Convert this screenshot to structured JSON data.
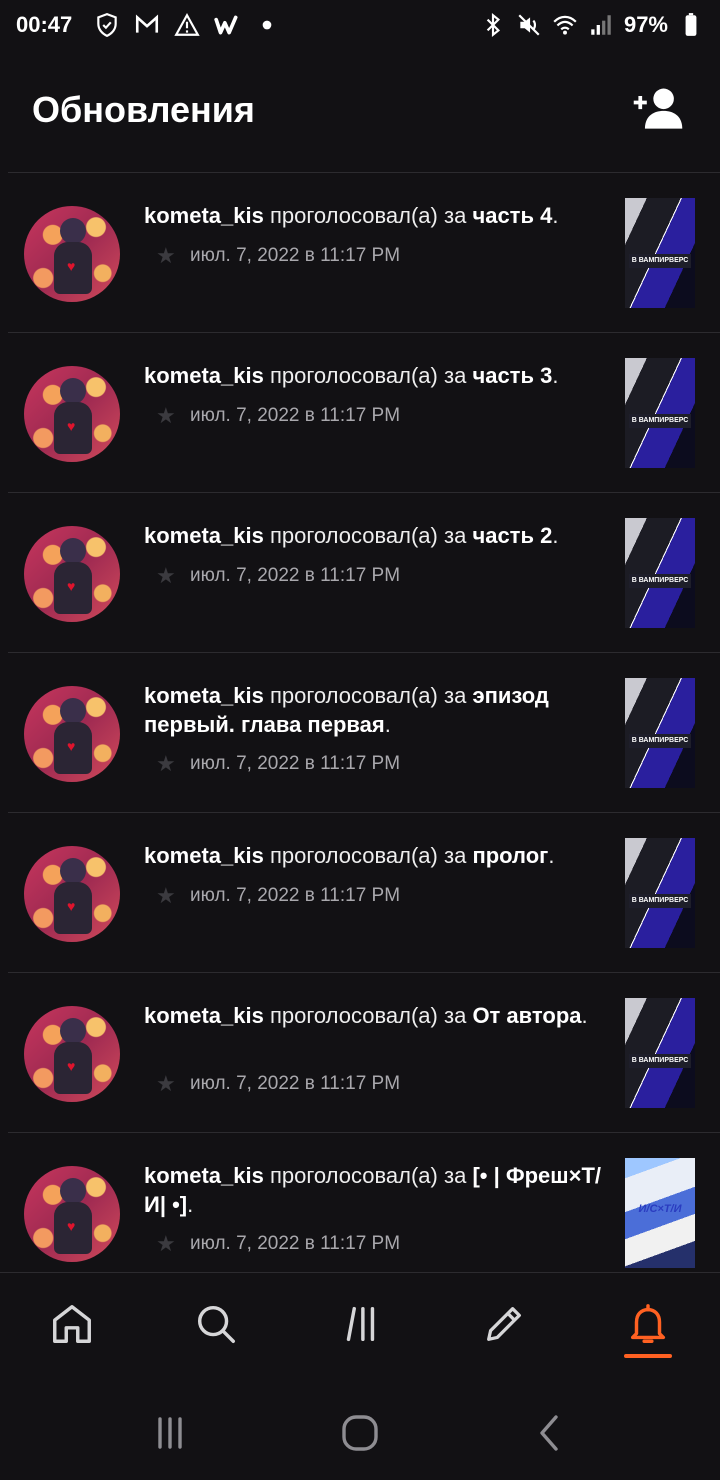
{
  "status_bar": {
    "time": "00:47",
    "battery": "97%",
    "left_icons": [
      "shield-icon",
      "gmail-icon",
      "warning-icon",
      "wattpad-icon",
      "dot-icon"
    ],
    "right_icons": [
      "bluetooth-icon",
      "mute-icon",
      "wifi-icon",
      "signal-icon"
    ]
  },
  "header": {
    "title": "Обновления",
    "action_icon": "add-friend-icon"
  },
  "feed": {
    "items": [
      {
        "user": "kometa_kis",
        "action": "проголосовал(а) за",
        "target": "часть 4",
        "time": "июл. 7, 2022 в 11:17 PM",
        "cover": "dark"
      },
      {
        "user": "kometa_kis",
        "action": "проголосовал(а) за",
        "target": "часть 3",
        "time": "июл. 7, 2022 в 11:17 PM",
        "cover": "dark"
      },
      {
        "user": "kometa_kis",
        "action": "проголосовал(а) за",
        "target": "часть 2",
        "time": "июл. 7, 2022 в 11:17 PM",
        "cover": "dark"
      },
      {
        "user": "kometa_kis",
        "action": "проголосовал(а) за",
        "target": "эпизод первый. глава первая",
        "time": "июл. 7, 2022 в 11:17 PM",
        "cover": "dark"
      },
      {
        "user": "kometa_kis",
        "action": "проголосовал(а) за",
        "target": "пролог",
        "time": "июл. 7, 2022 в 11:17 PM",
        "cover": "dark"
      },
      {
        "user": "kometa_kis",
        "action": "проголосовал(а) за",
        "target": "От автора",
        "time": "июл. 7, 2022 в 11:17 PM",
        "cover": "dark"
      },
      {
        "user": "kometa_kis",
        "action": "проголосовал(а) за",
        "target": "[• | Фреш×Т/И| •]",
        "time": "июл. 7, 2022 в 11:17 PM",
        "cover": "light"
      }
    ],
    "dark_cover_text": "В ВАМПИРВЕРС",
    "light_cover_text": "И/С×Т/И"
  },
  "bottom_nav": {
    "items": [
      "home-icon",
      "search-icon",
      "library-icon",
      "write-icon",
      "notifications-icon"
    ],
    "active": "notifications-icon",
    "accent": "#ff6122"
  },
  "system_nav": {
    "items": [
      "recents-icon",
      "home-circle-icon",
      "back-icon"
    ]
  }
}
